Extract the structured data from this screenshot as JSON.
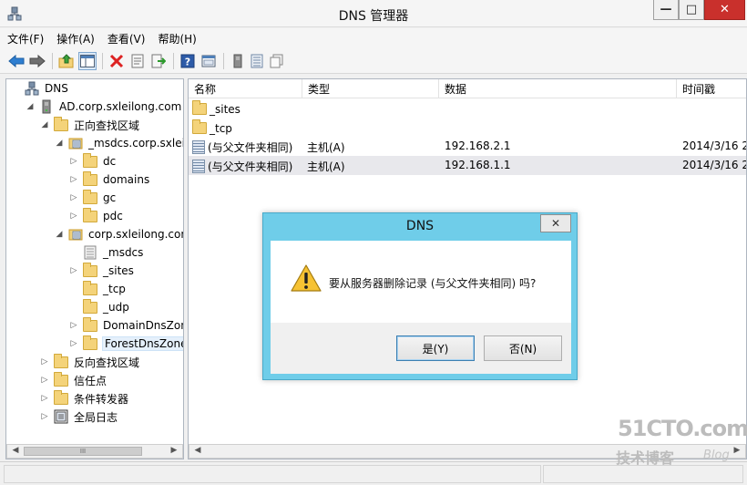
{
  "window": {
    "title": "DNS 管理器",
    "min_glyph": "—",
    "max_glyph": "□",
    "close_glyph": "✕"
  },
  "menu": {
    "items": [
      "文件(F)",
      "操作(A)",
      "查看(V)",
      "帮助(H)"
    ]
  },
  "toolbar": {
    "buttons": [
      "back-icon",
      "forward-icon",
      "up-folder-icon",
      "show-tree-icon",
      "delete-icon",
      "properties-icon",
      "export-icon",
      "help-icon",
      "console-icon",
      "server-icon",
      "list-icon",
      "copy-icon"
    ]
  },
  "tree": {
    "items": [
      {
        "label": "DNS",
        "icon": "dns-icon",
        "level": 0,
        "expander": ""
      },
      {
        "label": "AD.corp.sxleilong.com",
        "icon": "server-icon",
        "level": 1,
        "expander": "◢"
      },
      {
        "label": "正向查找区域",
        "icon": "folder-icon",
        "level": 2,
        "expander": "◢"
      },
      {
        "label": "_msdcs.corp.sxleilo",
        "icon": "zone-icon",
        "level": 3,
        "expander": "◢"
      },
      {
        "label": "dc",
        "icon": "folder-icon",
        "level": 4,
        "expander": "▷"
      },
      {
        "label": "domains",
        "icon": "folder-icon",
        "level": 4,
        "expander": "▷"
      },
      {
        "label": "gc",
        "icon": "folder-icon",
        "level": 4,
        "expander": "▷"
      },
      {
        "label": "pdc",
        "icon": "folder-icon",
        "level": 4,
        "expander": "▷"
      },
      {
        "label": "corp.sxleilong.com",
        "icon": "zone-icon",
        "level": 3,
        "expander": "◢"
      },
      {
        "label": "_msdcs",
        "icon": "delegation-icon",
        "level": 4,
        "expander": ""
      },
      {
        "label": "_sites",
        "icon": "folder-icon",
        "level": 4,
        "expander": "▷"
      },
      {
        "label": "_tcp",
        "icon": "folder-icon",
        "level": 4,
        "expander": ""
      },
      {
        "label": "_udp",
        "icon": "folder-icon",
        "level": 4,
        "expander": ""
      },
      {
        "label": "DomainDnsZone",
        "icon": "folder-icon",
        "level": 4,
        "expander": "▷"
      },
      {
        "label": "ForestDnsZones",
        "icon": "folder-icon",
        "level": 4,
        "expander": "▷",
        "selected": true
      },
      {
        "label": "反向查找区域",
        "icon": "folder-icon",
        "level": 2,
        "expander": "▷"
      },
      {
        "label": "信任点",
        "icon": "folder-icon",
        "level": 2,
        "expander": "▷"
      },
      {
        "label": "条件转发器",
        "icon": "folder-icon",
        "level": 2,
        "expander": "▷"
      },
      {
        "label": "全局日志",
        "icon": "log-icon",
        "level": 2,
        "expander": "▷"
      }
    ]
  },
  "list": {
    "columns": [
      "名称",
      "类型",
      "数据",
      "时间戳"
    ],
    "rows": [
      {
        "icon": "folder-icon",
        "name": "_sites",
        "type": "",
        "data": "",
        "timestamp": ""
      },
      {
        "icon": "folder-icon",
        "name": "_tcp",
        "type": "",
        "data": "",
        "timestamp": ""
      },
      {
        "icon": "record-icon",
        "name": "(与父文件夹相同)",
        "type": "主机(A)",
        "data": "192.168.2.1",
        "timestamp": "2014/3/16 2"
      },
      {
        "icon": "record-icon",
        "name": "(与父文件夹相同)",
        "type": "主机(A)",
        "data": "192.168.1.1",
        "timestamp": "2014/3/16 2",
        "highlighted": true
      }
    ]
  },
  "scrollbar": {
    "left_arrow": "◀",
    "right_arrow": "▶",
    "thumb_glyph": "III"
  },
  "dialog": {
    "title": "DNS",
    "close_glyph": "✕",
    "message": "要从服务器删除记录 (与父文件夹相同) 吗?",
    "yes_label": "是(Y)",
    "no_label": "否(N)"
  },
  "watermark": {
    "top": "51CTO.com",
    "bottom": "技术博客",
    "blog": "Blog"
  },
  "colors": {
    "dialog_frame": "#6fcde9",
    "close_button": "#c9302c",
    "folder": "#f4d37a"
  }
}
